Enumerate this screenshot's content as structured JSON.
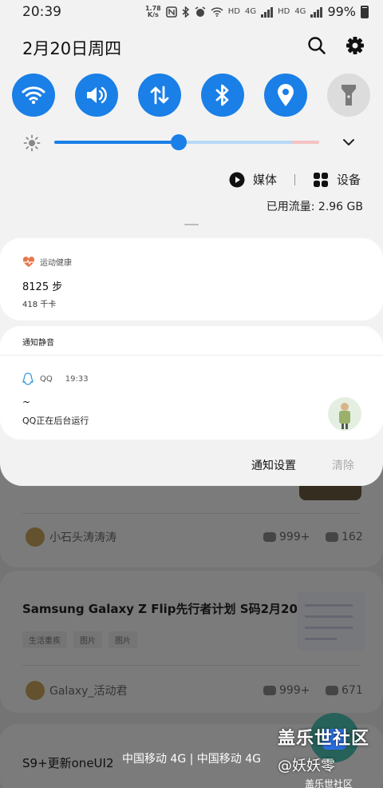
{
  "status_bar": {
    "time": "20:39",
    "net_speed_value": "1.78",
    "net_speed_unit": "K/s",
    "hd1": "HD",
    "net1": "4G",
    "hd2": "HD",
    "net2": "4G",
    "battery": "99%"
  },
  "header": {
    "date": "2月20日周四"
  },
  "quick_toggles": [
    {
      "name": "wifi",
      "icon": "wifi-icon",
      "on": true
    },
    {
      "name": "sound",
      "icon": "sound-icon",
      "on": true
    },
    {
      "name": "mobile-data",
      "icon": "data-arrows-icon",
      "on": true
    },
    {
      "name": "bluetooth",
      "icon": "bluetooth-icon",
      "on": true
    },
    {
      "name": "location",
      "icon": "location-icon",
      "on": true
    },
    {
      "name": "flashlight",
      "icon": "flashlight-icon",
      "on": false
    }
  ],
  "brightness": {
    "level_percent": 47
  },
  "media_row": {
    "media_label": "媒体",
    "devices_label": "设备"
  },
  "data_usage": "已用流量: 2.96 GB",
  "notifications": {
    "health": {
      "app_name": "运动健康",
      "steps": "8125 步",
      "calories": "418 千卡"
    },
    "silent_section": {
      "label": "通知静音"
    },
    "qq": {
      "app_name": "QQ",
      "time": "19:33",
      "message": "~",
      "subtext": "QQ正在后台运行"
    }
  },
  "panel_actions": {
    "settings_label": "通知设置",
    "clear_label": "清除"
  },
  "background": {
    "post1_user": "小石头涛涛涛",
    "post1_views": "999+",
    "post1_comments": "162",
    "post2_title": "Samsung Galaxy Z Flip先行者计划 S码2月20...",
    "post2_tags": [
      "生活重疾",
      "图片",
      "图片"
    ],
    "post2_user": "Galaxy_活动君",
    "post2_views": "999+",
    "post2_comments": "671",
    "post3_title": "S9+更新oneUI2",
    "fab_label": "盖乐世社区",
    "carrier": "中国移动 4G | 中国移动 4G",
    "watermark_title": "盖乐世社区",
    "watermark_user": "@妖妖零"
  },
  "colors": {
    "accent": "#1a7fe6",
    "panel_bg": "#f2f2f2",
    "card_bg": "#ffffff"
  }
}
